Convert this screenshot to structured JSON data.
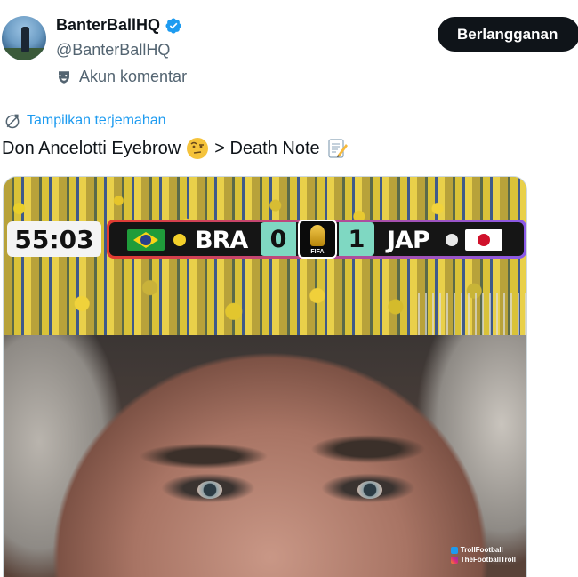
{
  "author": {
    "display_name": "BanterBallHQ",
    "handle": "@BanterBallHQ",
    "account_label": "Akun komentar",
    "verified": true
  },
  "actions": {
    "subscribe_label": "Berlangganan"
  },
  "translate": {
    "label": "Tampilkan terjemahan"
  },
  "tweet": {
    "text_part1": "Don Ancelotti Eyebrow",
    "text_part2": "> Death Note",
    "emoji_1": "raised-eyebrow-face",
    "emoji_2": "memo"
  },
  "media": {
    "scoreboard": {
      "clock": "55:03",
      "home_team": "BRA",
      "away_team": "JAP",
      "home_score": "0",
      "away_score": "1",
      "competition_badge": "FIFA"
    },
    "watermark": {
      "twitter": "TrollFootball",
      "instagram": "TheFootballTroll"
    }
  },
  "colors": {
    "accent": "#1d9bf0",
    "button_bg": "#0f1419",
    "secondary_text": "#536471",
    "score_box": "#7fd8c2"
  }
}
